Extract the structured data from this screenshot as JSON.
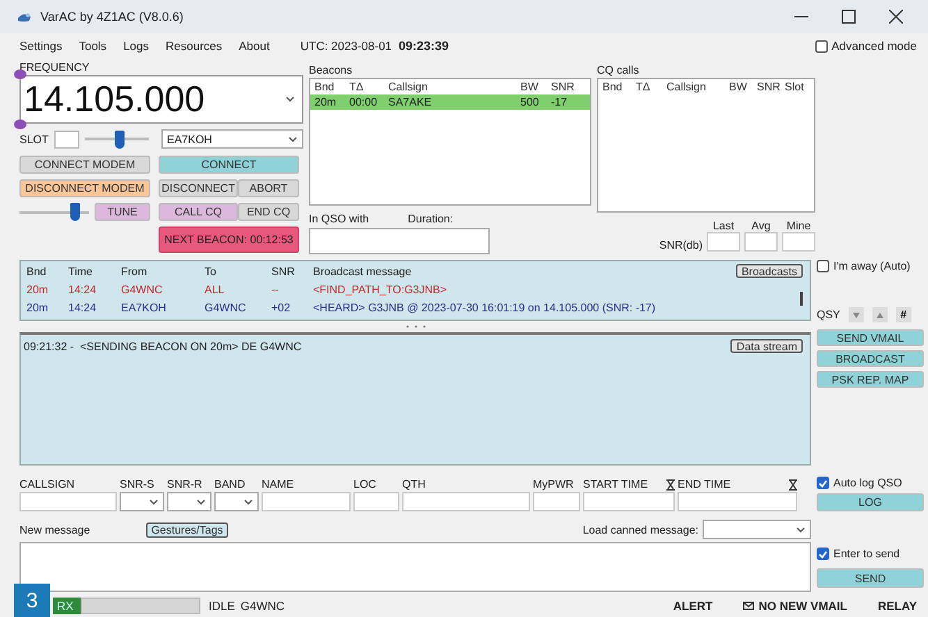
{
  "window": {
    "title": "VarAC by 4Z1AC (V8.0.6)"
  },
  "menu": [
    "Settings",
    "Tools",
    "Logs",
    "Resources",
    "About"
  ],
  "clock": {
    "label": "UTC: 2023-08-01",
    "time": "09:23:39"
  },
  "advanced_mode": {
    "label": "Advanced mode",
    "checked": false
  },
  "frequency": {
    "label": "FREQUENCY",
    "value": "14.105.000"
  },
  "slot": {
    "label": "SLOT"
  },
  "power_slider": {
    "level": 0.55
  },
  "callsign_select": {
    "value": "EA7KOH"
  },
  "tune_slider": {
    "level": 0.8
  },
  "buttons": [
    {
      "label": "CONNECT MODEM",
      "kind": "neutral"
    },
    {
      "label": "CONNECT",
      "kind": "primary"
    },
    {
      "label": "DISCONNECT MODEM",
      "kind": "warning"
    },
    {
      "label": "DISCONNECT",
      "kind": "neutral"
    },
    {
      "label": "ABORT",
      "kind": "neutral"
    },
    {
      "label": "TUNE",
      "kind": "cq"
    },
    {
      "label": "CALL CQ",
      "kind": "cq"
    },
    {
      "label": "END CQ",
      "kind": "neutral"
    },
    {
      "label": "NEXT BEACON: 00:12:53",
      "kind": "alert"
    }
  ],
  "beacons": {
    "label": "Beacons",
    "columns": [
      "Bnd",
      "TΔ",
      "Callsign",
      "BW",
      "SNR"
    ],
    "rows": [
      {
        "cells": [
          "20m",
          "00:00",
          "SA7AKE",
          "500",
          "-17"
        ],
        "selected": true
      }
    ]
  },
  "cq_calls": {
    "label": "CQ calls",
    "columns": [
      "Bnd",
      "TΔ",
      "Callsign",
      "BW",
      "SNR",
      "Slot"
    ]
  },
  "qso": {
    "with_label": "In QSO with",
    "duration_label": "Duration:"
  },
  "snr": {
    "label": "SNR(db)",
    "columns": [
      "Last",
      "Avg",
      "Mine"
    ]
  },
  "broadcasts": {
    "button": "Broadcasts",
    "columns": [
      "Bnd",
      "Time",
      "From",
      "To",
      "SNR",
      "Broadcast message"
    ],
    "rows": [
      {
        "cells": [
          "20m",
          "14:24",
          "G4WNC",
          "ALL",
          "--",
          "<FIND_PATH_TO:G3JNB>"
        ],
        "color": "#c0282d"
      },
      {
        "cells": [
          "20m",
          "14:24",
          "EA7KOH",
          "G4WNC",
          "+02",
          "<HEARD> G3JNB @ 2023-07-30 16:01:19 on 14.105.000 (SNR: -17)"
        ],
        "color": "#24308a"
      }
    ]
  },
  "data_stream": {
    "button": "Data stream",
    "lines": [
      "09:21:32 -  <SENDING BEACON ON 20m> DE G4WNC"
    ]
  },
  "away": {
    "label": "I'm away (Auto)",
    "checked": false
  },
  "qsy": {
    "label": "QSY",
    "buttons": [
      {
        "kind": "down"
      },
      {
        "kind": "up"
      },
      {
        "kind": "text",
        "label": "#"
      }
    ]
  },
  "side_buttons": [
    "SEND VMAIL",
    "BROADCAST",
    "PSK REP. MAP"
  ],
  "log_fields": [
    {
      "label": "CALLSIGN",
      "kind": "text"
    },
    {
      "label": "SNR-S",
      "kind": "select"
    },
    {
      "label": "SNR-R",
      "kind": "select"
    },
    {
      "label": "BAND",
      "kind": "select"
    },
    {
      "label": "NAME",
      "kind": "text"
    },
    {
      "label": "LOC",
      "kind": "text"
    },
    {
      "label": "QTH",
      "kind": "text"
    },
    {
      "label": "MyPWR",
      "kind": "text"
    },
    {
      "label": "START TIME",
      "kind": "time"
    },
    {
      "label": "END TIME",
      "kind": "time"
    }
  ],
  "auto_log": {
    "label": "Auto log QSO",
    "checked": true
  },
  "log_button": "LOG",
  "new_message": {
    "label": "New message",
    "tags_button": "Gestures/Tags",
    "canned_label": "Load canned message:"
  },
  "enter_to_send": {
    "label": "Enter to send",
    "checked": true
  },
  "send_button": "SEND",
  "status_bar": {
    "mode": "RX",
    "progress": {
      "level": 0
    },
    "state": "IDLE",
    "callsign": "G4WNC",
    "items": [
      {
        "label": "ALERT",
        "kind": "text"
      },
      {
        "label": "NO NEW VMAIL",
        "kind": "mail"
      },
      {
        "label": "RELAY",
        "kind": "text"
      }
    ]
  },
  "figure_number": "3"
}
